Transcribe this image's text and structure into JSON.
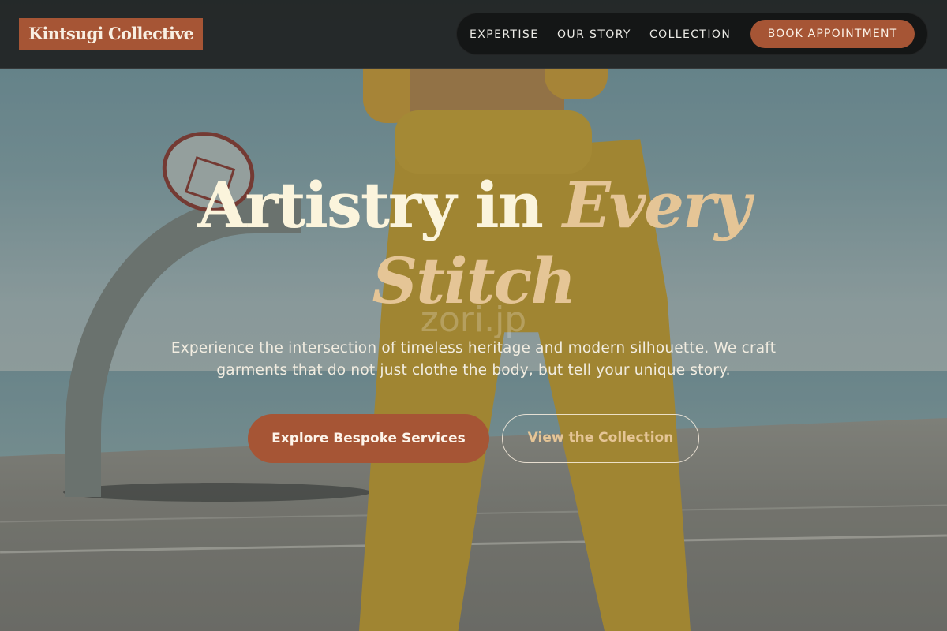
{
  "brand": {
    "name": "Kintsugi Collective"
  },
  "nav": {
    "items": [
      {
        "label": "EXPERTISE"
      },
      {
        "label": "OUR STORY"
      },
      {
        "label": "COLLECTION"
      }
    ],
    "cta_label": "BOOK APPOINTMENT"
  },
  "hero": {
    "headline_plain": "Artistry in",
    "headline_accent_1": "Every",
    "headline_accent_2": "Stitch",
    "subtitle_line1": "Experience the intersection of timeless heritage and modern silhouette. We craft",
    "subtitle_line2": "garments that do not just clothe the body, but tell your unique story.",
    "primary_button": "Explore Bespoke Services",
    "secondary_button": "View the Collection",
    "watermark": "zori.jp"
  },
  "colors": {
    "accent": "#a65535",
    "headline": "#fbf4dc",
    "headline_accent": "#e5c596",
    "header_bg": "#202222"
  }
}
